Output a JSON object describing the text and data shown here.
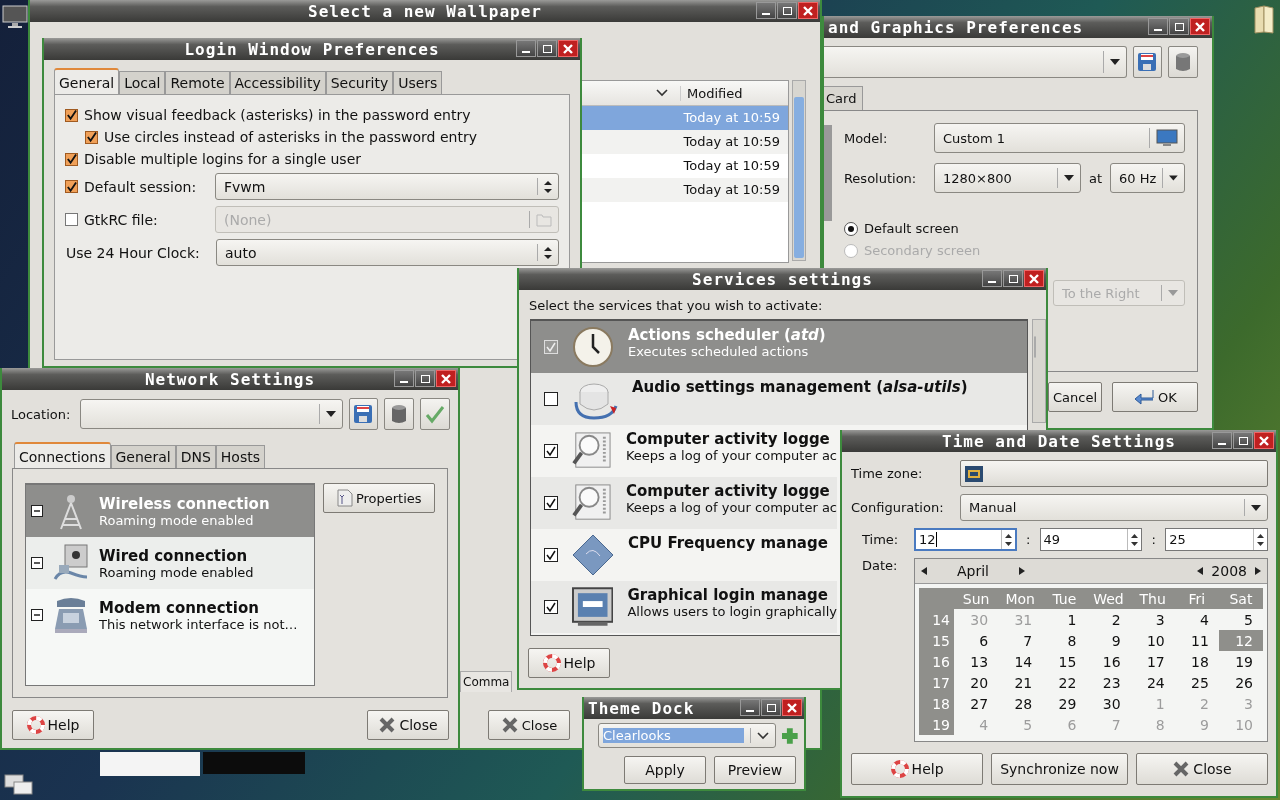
{
  "wallpaper_window": {
    "title": "Select a new Wallpaper",
    "column": "Modified",
    "rows": [
      {
        "modified": "Today at 10:59",
        "selected": true
      },
      {
        "modified": "Today at 10:59",
        "selected": false
      },
      {
        "modified": "Today at 10:59",
        "selected": false
      },
      {
        "modified": "Today at 10:59",
        "selected": false
      }
    ],
    "tab": "Comma",
    "close_button": "Close"
  },
  "display_window": {
    "title": "and Graphics Preferences",
    "tab": "Card",
    "model_label": "Model:",
    "model": "Custom 1",
    "resolution_label": "Resolution:",
    "resolution": "1280×800",
    "at": "at",
    "rate": "60 Hz",
    "screens": [
      {
        "label": "Default screen",
        "selected": true,
        "disabled": false
      },
      {
        "label": "Secondary screen",
        "selected": false,
        "disabled": true
      }
    ],
    "position": "To the Right",
    "cancel_button": "Cancel",
    "ok_button": "OK"
  },
  "login_window": {
    "title": "Login Window Preferences",
    "tabs": [
      {
        "label": "General",
        "selected": true
      },
      {
        "label": "Local",
        "selected": false
      },
      {
        "label": "Remote",
        "selected": false
      },
      {
        "label": "Accessibility",
        "selected": false
      },
      {
        "label": "Security",
        "selected": false
      },
      {
        "label": "Users",
        "selected": false
      }
    ],
    "options": [
      {
        "label": "Show visual feedback (asterisks) in the password entry",
        "checked": true,
        "children": [
          {
            "label": "Use circles instead of asterisks in the password entry",
            "checked": true
          }
        ]
      },
      {
        "label": "Disable multiple logins for a single user",
        "checked": true
      }
    ],
    "fields": [
      {
        "kind": "combo",
        "label": "Default session:",
        "checked": true,
        "value": "Fvwm",
        "disabled": false
      },
      {
        "kind": "file",
        "label": "GtkRC file:",
        "checked": false,
        "value": "(None)",
        "disabled": true
      },
      {
        "kind": "combo",
        "label": "Use 24 Hour Clock:",
        "value": "auto",
        "disabled": false
      }
    ]
  },
  "network_window": {
    "title": "Network Settings",
    "location_label": "Location:",
    "tabs": [
      {
        "label": "Connections",
        "selected": true
      },
      {
        "label": "General",
        "selected": false
      },
      {
        "label": "DNS",
        "selected": false
      },
      {
        "label": "Hosts",
        "selected": false
      }
    ],
    "connections": [
      {
        "kind": "wireless",
        "name": "Wireless connection",
        "status": "Roaming mode enabled",
        "selected": true
      },
      {
        "kind": "wired",
        "name": "Wired connection",
        "status": "Roaming mode enabled",
        "selected": false
      },
      {
        "kind": "modem",
        "name": "Modem connection",
        "status": "This network interface is not…",
        "selected": false
      }
    ],
    "properties_button": "Properties",
    "help_button": "Help",
    "close_button": "Close"
  },
  "services_window": {
    "title": "Services settings",
    "prompt": "Select the services that you wish to activate:",
    "services": [
      {
        "kind": "clock",
        "name": "Actions scheduler (*atd*)",
        "description": "Executes scheduled actions",
        "checked": true,
        "selected": true
      },
      {
        "kind": "audio",
        "name": "Audio settings management (*alsa-utils*)",
        "checked": false,
        "selected": false
      },
      {
        "kind": "log",
        "name": "Computer activity logge",
        "description": "Keeps a log of your computer ac",
        "checked": true,
        "selected": false
      },
      {
        "kind": "log",
        "name": "Computer activity logge",
        "description": "Keeps a log of your computer ac",
        "checked": true,
        "selected": false
      },
      {
        "kind": "cpu",
        "name": "CPU Frequency manage",
        "checked": true,
        "selected": false
      },
      {
        "kind": "login",
        "name": "Graphical login manage",
        "description": "Allows users to login graphically",
        "checked": true,
        "selected": false
      }
    ],
    "help_button": "Help"
  },
  "theme_dock": {
    "title": "Theme Dock",
    "value": "Clearlooks",
    "value_selected": true,
    "apply_button": "Apply",
    "preview_button": "Preview"
  },
  "time_window": {
    "title": "Time and Date Settings",
    "timezone_label": "Time zone:",
    "config_label": "Configuration:",
    "config": "Manual",
    "time_label": "Time:",
    "time": [
      {
        "value": "12",
        "focused": true
      },
      {
        "value": "49",
        "focused": false
      },
      {
        "value": "25",
        "focused": false
      }
    ],
    "separator": ":",
    "date_label": "Date:",
    "month": "April",
    "year": "2008",
    "weekdays": [
      "Sun",
      "Mon",
      "Tue",
      "Wed",
      "Thu",
      "Fri",
      "Sat"
    ],
    "weeks": [
      {
        "number": "14",
        "days": [
          {
            "day": "30",
            "other_month": true,
            "selected": false
          },
          {
            "day": "31",
            "other_month": true,
            "selected": false
          },
          {
            "day": "1",
            "other_month": false,
            "selected": false
          },
          {
            "day": "2",
            "other_month": false,
            "selected": false
          },
          {
            "day": "3",
            "other_month": false,
            "selected": false
          },
          {
            "day": "4",
            "other_month": false,
            "selected": false
          },
          {
            "day": "5",
            "other_month": false,
            "selected": false
          }
        ]
      },
      {
        "number": "15",
        "days": [
          {
            "day": "6",
            "other_month": false,
            "selected": false
          },
          {
            "day": "7",
            "other_month": false,
            "selected": false
          },
          {
            "day": "8",
            "other_month": false,
            "selected": false
          },
          {
            "day": "9",
            "other_month": false,
            "selected": false
          },
          {
            "day": "10",
            "other_month": false,
            "selected": false
          },
          {
            "day": "11",
            "other_month": false,
            "selected": false
          },
          {
            "day": "12",
            "other_month": false,
            "selected": true
          }
        ]
      },
      {
        "number": "16",
        "days": [
          {
            "day": "13",
            "other_month": false,
            "selected": false
          },
          {
            "day": "14",
            "other_month": false,
            "selected": false
          },
          {
            "day": "15",
            "other_month": false,
            "selected": false
          },
          {
            "day": "16",
            "other_month": false,
            "selected": false
          },
          {
            "day": "17",
            "other_month": false,
            "selected": false
          },
          {
            "day": "18",
            "other_month": false,
            "selected": false
          },
          {
            "day": "19",
            "other_month": false,
            "selected": false
          }
        ]
      },
      {
        "number": "17",
        "days": [
          {
            "day": "20",
            "other_month": false,
            "selected": false
          },
          {
            "day": "21",
            "other_month": false,
            "selected": false
          },
          {
            "day": "22",
            "other_month": false,
            "selected": false
          },
          {
            "day": "23",
            "other_month": false,
            "selected": false
          },
          {
            "day": "24",
            "other_month": false,
            "selected": false
          },
          {
            "day": "25",
            "other_month": false,
            "selected": false
          },
          {
            "day": "26",
            "other_month": false,
            "selected": false
          }
        ]
      },
      {
        "number": "18",
        "days": [
          {
            "day": "27",
            "other_month": false,
            "selected": false
          },
          {
            "day": "28",
            "other_month": false,
            "selected": false
          },
          {
            "day": "29",
            "other_month": false,
            "selected": false
          },
          {
            "day": "30",
            "other_month": false,
            "selected": false
          },
          {
            "day": "1",
            "other_month": true,
            "selected": false
          },
          {
            "day": "2",
            "other_month": true,
            "selected": false
          },
          {
            "day": "3",
            "other_month": true,
            "selected": false
          }
        ]
      },
      {
        "number": "19",
        "days": [
          {
            "day": "4",
            "other_month": true,
            "selected": false
          },
          {
            "day": "5",
            "other_month": true,
            "selected": false
          },
          {
            "day": "6",
            "other_month": true,
            "selected": false
          },
          {
            "day": "7",
            "other_month": true,
            "selected": false
          },
          {
            "day": "8",
            "other_month": true,
            "selected": false
          },
          {
            "day": "9",
            "other_month": true,
            "selected": false
          },
          {
            "day": "10",
            "other_month": true,
            "selected": false
          }
        ]
      }
    ],
    "help_button": "Help",
    "sync_button": "Synchronize now",
    "close_button": "Close"
  }
}
